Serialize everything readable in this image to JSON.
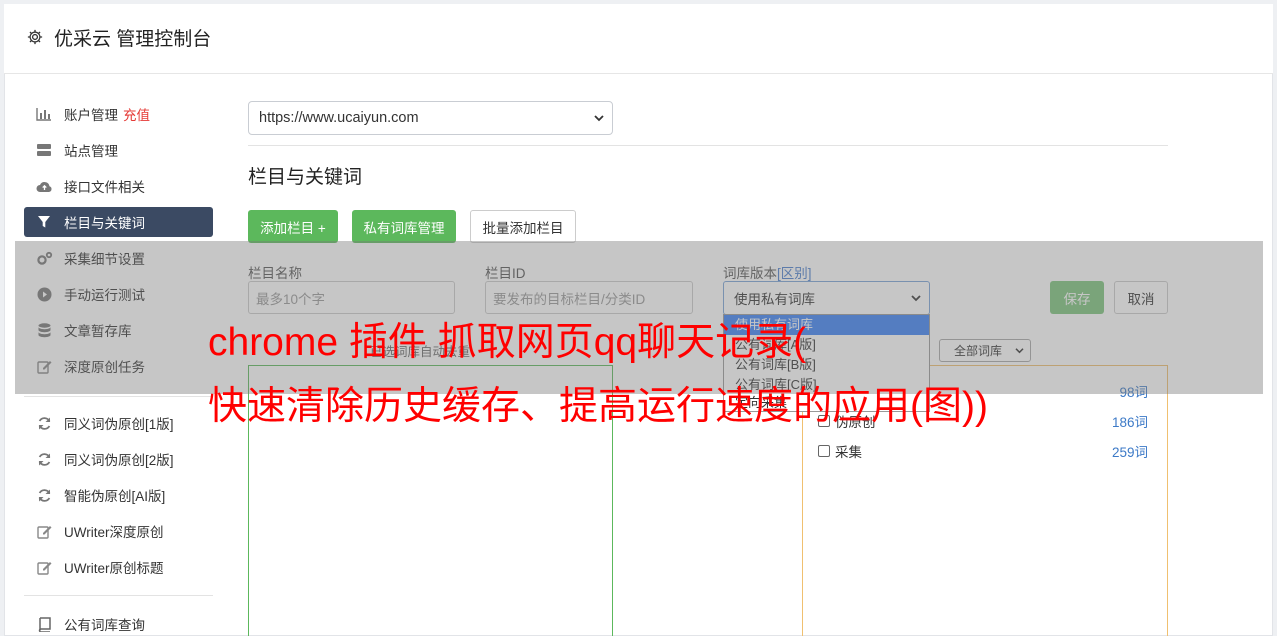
{
  "header": {
    "title": "优采云 管理控制台"
  },
  "sidebar": {
    "items": [
      {
        "label": "账户管理",
        "tag": "充值",
        "icon": "bar-chart-icon"
      },
      {
        "label": "站点管理",
        "icon": "server-icon"
      },
      {
        "label": "接口文件相关",
        "icon": "cloud-upload-icon"
      },
      {
        "label": "栏目与关键词",
        "icon": "filter-icon",
        "active": true
      },
      {
        "label": "采集细节设置",
        "icon": "gears-icon"
      },
      {
        "label": "手动运行测试",
        "icon": "play-circle-icon"
      },
      {
        "label": "文章暂存库",
        "icon": "database-icon"
      },
      {
        "label": "深度原创任务",
        "icon": "edit-icon"
      },
      {
        "label": "同义词伪原创[1版]",
        "icon": "refresh-icon"
      },
      {
        "label": "同义词伪原创[2版]",
        "icon": "refresh-icon"
      },
      {
        "label": "智能伪原创[AI版]",
        "icon": "refresh-icon"
      },
      {
        "label": "UWriter深度原创",
        "icon": "edit-icon"
      },
      {
        "label": "UWriter原创标题",
        "icon": "edit-icon"
      },
      {
        "label": "公有词库查询",
        "icon": "book-icon"
      }
    ]
  },
  "main": {
    "site_select": "https://www.ucaiyun.com",
    "section_title": "栏目与关键词",
    "buttons": {
      "add_column": "添加栏目 +",
      "private_lib": "私有词库管理",
      "batch_add": "批量添加栏目",
      "save": "保存",
      "cancel": "取消"
    },
    "form": {
      "name_label": "栏目名称",
      "name_placeholder": "最多10个字",
      "id_label": "栏目ID",
      "id_placeholder": "要发布的目标栏目/分类ID",
      "lib_label": "词库版本",
      "lib_label_hl": "[区别]",
      "lib_value": "使用私有词库",
      "lib_filter": "全部词库"
    },
    "dropdown_options": [
      "使用私有词库",
      "公有词库[A版]",
      "公有词库[B版]",
      "公有词库[C版]",
      "定向采集"
    ],
    "hint_text": "已选词库自动去重",
    "words": [
      {
        "label": "",
        "count": "98词"
      },
      {
        "label": "伪原创",
        "count": "186词"
      },
      {
        "label": "采集",
        "count": "259词"
      }
    ]
  },
  "banner": {
    "line1": "chrome 插件 抓取网页qq聊天记录(",
    "line2": "快速清除历史缓存、提高运行速度的应用(图))"
  },
  "colors": {
    "active_nav": "#3b4a63",
    "accent_green": "#5cb85c",
    "banner_red": "#ff0000",
    "recharge_red": "#e53935",
    "link_blue": "#3d7ac7"
  }
}
